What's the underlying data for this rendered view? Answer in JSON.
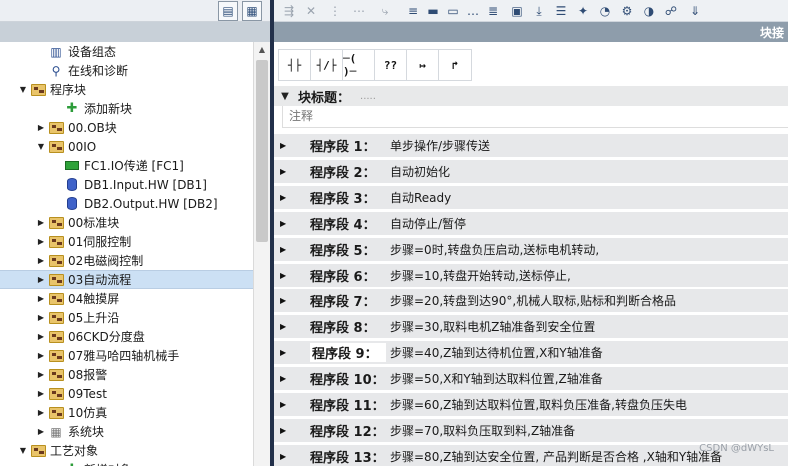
{
  "tree": {
    "items": [
      {
        "label": "设备组态",
        "depth": 1,
        "expand": "",
        "icon": "device-config-icon"
      },
      {
        "label": "在线和诊断",
        "depth": 1,
        "expand": "",
        "icon": "online-diagnostics-icon"
      },
      {
        "label": "程序块",
        "depth": 0,
        "expand": "open",
        "icon": "folder-icon"
      },
      {
        "label": "添加新块",
        "depth": 2,
        "expand": "",
        "icon": "add-block-icon"
      },
      {
        "label": "00.OB块",
        "depth": 1,
        "expand": "closed",
        "icon": "folder-icon"
      },
      {
        "label": "00IO",
        "depth": 1,
        "expand": "open",
        "icon": "folder-icon"
      },
      {
        "label": "FC1.IO传递 [FC1]",
        "depth": 2,
        "expand": "",
        "icon": "fc-block-icon"
      },
      {
        "label": "DB1.Input.HW [DB1]",
        "depth": 2,
        "expand": "",
        "icon": "db-block-icon"
      },
      {
        "label": "DB2.Output.HW [DB2]",
        "depth": 2,
        "expand": "",
        "icon": "db-block-icon"
      },
      {
        "label": "00标准块",
        "depth": 1,
        "expand": "closed",
        "icon": "folder-icon"
      },
      {
        "label": "01伺服控制",
        "depth": 1,
        "expand": "closed",
        "icon": "folder-icon"
      },
      {
        "label": "02电磁阀控制",
        "depth": 1,
        "expand": "closed",
        "icon": "folder-icon"
      },
      {
        "label": "03自动流程",
        "depth": 1,
        "expand": "closed",
        "icon": "folder-icon",
        "selected": true
      },
      {
        "label": "04触摸屏",
        "depth": 1,
        "expand": "closed",
        "icon": "folder-icon"
      },
      {
        "label": "05上升沿",
        "depth": 1,
        "expand": "closed",
        "icon": "folder-icon"
      },
      {
        "label": "06CKD分度盘",
        "depth": 1,
        "expand": "closed",
        "icon": "folder-icon"
      },
      {
        "label": "07雅马哈四轴机械手",
        "depth": 1,
        "expand": "closed",
        "icon": "folder-icon"
      },
      {
        "label": "08报警",
        "depth": 1,
        "expand": "closed",
        "icon": "folder-icon"
      },
      {
        "label": "09Test",
        "depth": 1,
        "expand": "closed",
        "icon": "folder-icon"
      },
      {
        "label": "10仿真",
        "depth": 1,
        "expand": "closed",
        "icon": "folder-icon"
      },
      {
        "label": "系统块",
        "depth": 1,
        "expand": "closed",
        "icon": "system-block-icon"
      },
      {
        "label": "工艺对象",
        "depth": 0,
        "expand": "open",
        "icon": "folder-icon"
      },
      {
        "label": "新增对象",
        "depth": 2,
        "expand": "",
        "icon": "add-block-icon"
      }
    ]
  },
  "editor": {
    "title_bar": "块接",
    "lad_buttons": [
      "┤├",
      "┤/├",
      "─( )─",
      "??",
      "↦",
      "↱"
    ],
    "block_title_label": "块标题：",
    "block_title_dots": ".....",
    "comment_placeholder": "注释",
    "networks": [
      {
        "label": "程序段 1：",
        "title": "单步操作/步骤传送"
      },
      {
        "label": "程序段 2：",
        "title": "自动初始化"
      },
      {
        "label": "程序段 3：",
        "title": "自动Ready"
      },
      {
        "label": "程序段 4：",
        "title": "自动停止/暂停"
      },
      {
        "label": "程序段 5：",
        "title": "步骤=0时,转盘负压启动,送标电机转动,"
      },
      {
        "label": "程序段 6：",
        "title": "步骤=10,转盘开始转动,送标停止,"
      },
      {
        "label": "程序段 7：",
        "title": "步骤=20,转盘到达90°,机械人取标,贴标和判断合格品"
      },
      {
        "label": "程序段 8：",
        "title": "步骤=30,取料电机Z轴准备到安全位置"
      },
      {
        "label": "程序段 9：",
        "title": "步骤=40,Z轴到达待机位置,X和Y轴准备"
      },
      {
        "label": "程序段 10：",
        "title": "步骤=50,X和Y轴到达取料位置,Z轴准备"
      },
      {
        "label": "程序段 11：",
        "title": "步骤=60,Z轴到达取料位置,取料负压准备,转盘负压失电"
      },
      {
        "label": "程序段 12：",
        "title": "步骤=70,取料负压取到料,Z轴准备"
      },
      {
        "label": "程序段 13：",
        "title": "步骤=80,Z轴到达安全位置, 产品判断是否合格 ,X轴和Y轴准备"
      }
    ]
  },
  "watermark": "CSDN @dWYsL",
  "colors": {
    "splitter": "#22304a",
    "title_bar": "#8e9dab",
    "network_row": "#e7e8ea",
    "selected_row": "#cce0f4"
  }
}
